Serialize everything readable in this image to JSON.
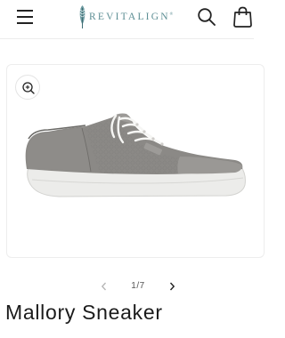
{
  "header": {
    "logo_text": "REVITALIGN",
    "logo_mark": "®",
    "icons": [
      "hamburger-menu-icon",
      "search-icon",
      "shopping-bag-icon"
    ]
  },
  "gallery": {
    "zoom_icon": "zoom-in-icon",
    "counter": "1/7",
    "current": 1,
    "total": 7,
    "prev_icon": "chevron-left-icon",
    "next_icon": "chevron-right-icon"
  },
  "product": {
    "title": "Mallory Sneaker"
  },
  "colors": {
    "brand": "#5e8f95",
    "shoe_upper": "#8b8986",
    "sole": "#ececea"
  }
}
